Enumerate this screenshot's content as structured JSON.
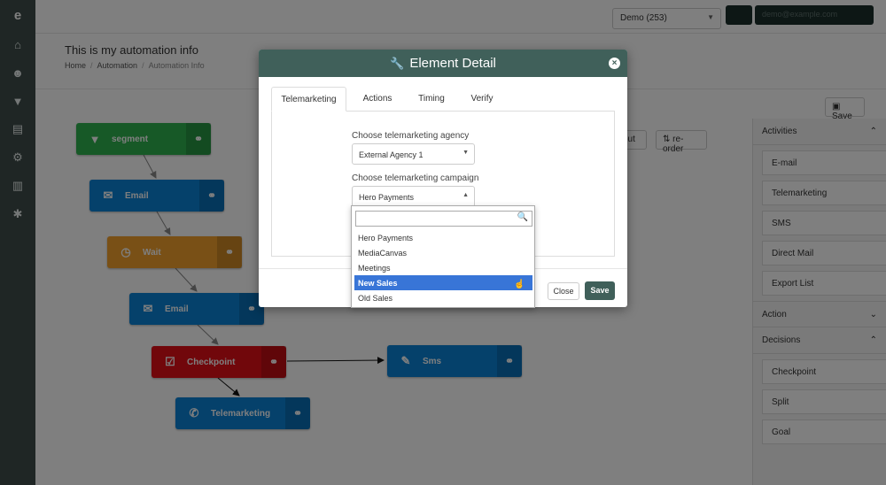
{
  "app": {
    "logo": "e"
  },
  "topbar": {
    "account_select": "Demo (253)",
    "user_label": "demo@example.com"
  },
  "page": {
    "title": "This is my automation info",
    "breadcrumb": [
      "Home",
      "Automation",
      "Automation Info"
    ]
  },
  "toolbar": {
    "save_label": "Save",
    "layout_label": "out",
    "reorder_label": "re-order"
  },
  "flow_nodes": [
    {
      "label": "segment",
      "color": "#2eb24f",
      "icon": "filter-icon"
    },
    {
      "label": "Email",
      "color": "#0b82d6",
      "icon": "envelope-icon"
    },
    {
      "label": "Wait",
      "color": "#f2a12c",
      "icon": "clock-icon"
    },
    {
      "label": "Email",
      "color": "#0b82d6",
      "icon": "envelope-icon"
    },
    {
      "label": "Checkpoint",
      "color": "#e20f17",
      "icon": "checkpoint-icon"
    },
    {
      "label": "Sms",
      "color": "#0b82d6",
      "icon": "chat-icon"
    },
    {
      "label": "Telemarketing",
      "color": "#0b82d6",
      "icon": "phone-icon"
    }
  ],
  "right_panel": {
    "sections": [
      {
        "title": "Activities",
        "expanded": true,
        "items": [
          "E-mail",
          "Telemarketing",
          "SMS",
          "Direct Mail",
          "Export List"
        ]
      },
      {
        "title": "Action",
        "expanded": false,
        "items": []
      },
      {
        "title": "Decisions",
        "expanded": true,
        "items": [
          "Checkpoint",
          "Split",
          "Goal"
        ]
      }
    ]
  },
  "modal": {
    "title": "Element Detail",
    "tabs": [
      "Telemarketing",
      "Actions",
      "Timing",
      "Verify"
    ],
    "active_tab": "Telemarketing",
    "agency_label": "Choose telemarketing agency",
    "agency_value": "External Agency 1",
    "campaign_label": "Choose telemarketing campaign",
    "campaign_value": "Hero Payments",
    "close_label": "Close",
    "save_label": "Save"
  },
  "campaign_dropdown": {
    "search_value": "",
    "options": [
      "Hero Payments",
      "MediaCanvas",
      "Meetings",
      "New Sales",
      "Old Sales"
    ],
    "highlighted": "New Sales"
  },
  "colors": {
    "accent": "#40605a",
    "highlight": "#3875d7"
  }
}
